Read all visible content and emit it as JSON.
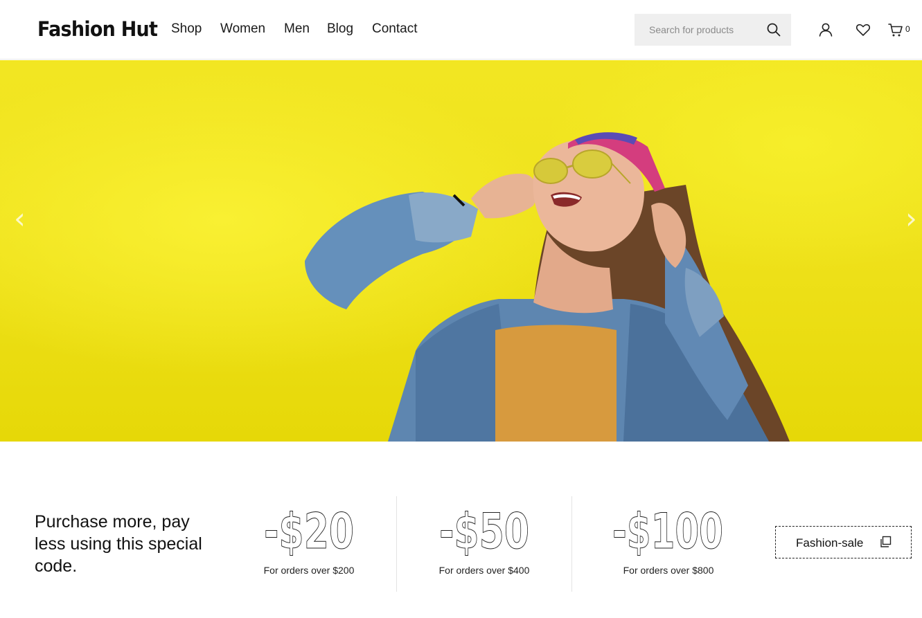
{
  "brand": {
    "name": "Fashion Hut"
  },
  "nav": {
    "items": [
      {
        "label": "Shop"
      },
      {
        "label": "Women"
      },
      {
        "label": "Men"
      },
      {
        "label": "Blog"
      },
      {
        "label": "Contact"
      }
    ]
  },
  "search": {
    "placeholder": "Search for products",
    "value": "",
    "icon": "search-icon"
  },
  "header_icons": {
    "account": "user-icon",
    "wishlist": "heart-icon",
    "cart": "cart-icon",
    "cart_count": "0"
  },
  "hero": {
    "slider_prev": "‹",
    "slider_next": "›",
    "background_color": "#efe21c",
    "image": "woman in sunglasses and denim jacket laughing against yellow wall"
  },
  "promo": {
    "headline": "Purchase more, pay less using this special code.",
    "offers": [
      {
        "amount": "-$20",
        "note": "For orders over $200"
      },
      {
        "amount": "-$50",
        "note": "For orders over $400"
      },
      {
        "amount": "-$100",
        "note": "For orders over $800"
      }
    ],
    "coupon": {
      "code": "Fashion-sale",
      "icon": "copy-icon"
    }
  }
}
